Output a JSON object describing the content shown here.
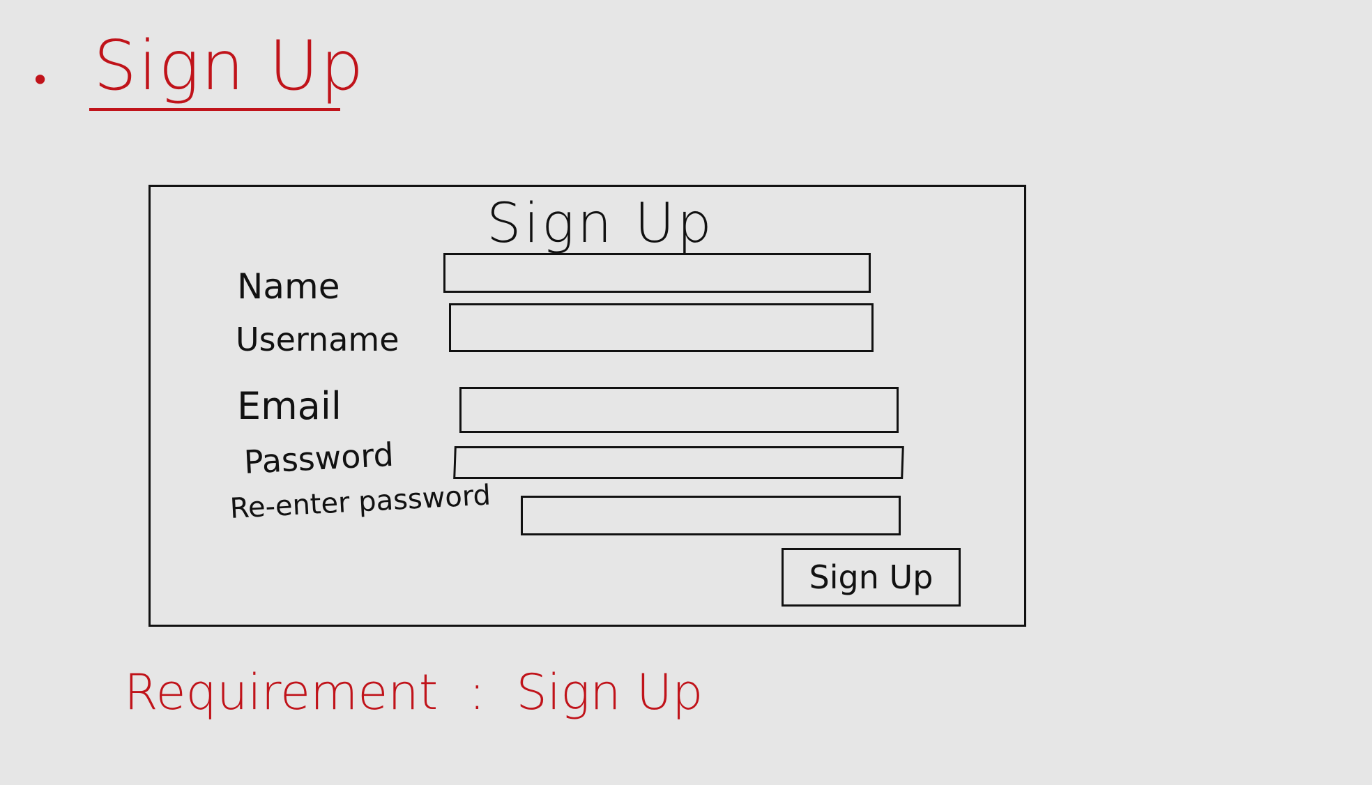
{
  "section": {
    "bullet": "•",
    "title": "Sign Up"
  },
  "form": {
    "title": "Sign Up",
    "fields": [
      {
        "label": "Name"
      },
      {
        "label": "Username"
      },
      {
        "label": "Email"
      },
      {
        "label": "Password"
      },
      {
        "label": "Re-enter password"
      }
    ],
    "button_label": "Sign Up"
  },
  "requirement": {
    "prefix": "Requirement",
    "separator": ":",
    "value": "Sign Up"
  },
  "colors": {
    "annotation": "#c0131a",
    "ink": "#111111",
    "background": "#e6e6e6"
  }
}
